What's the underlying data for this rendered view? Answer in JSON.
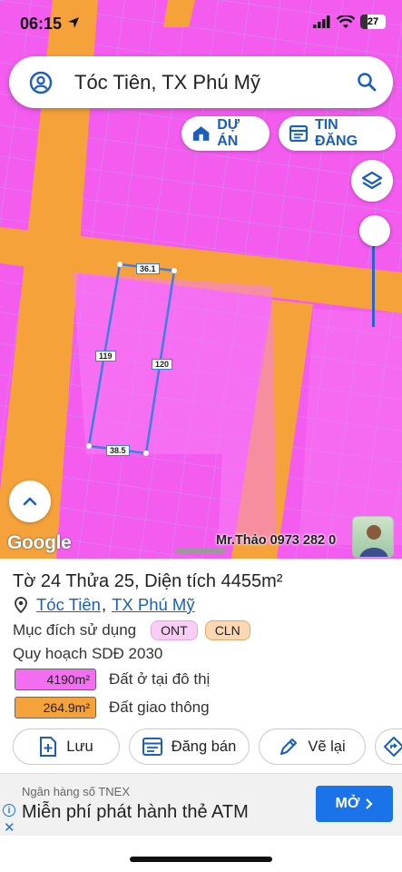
{
  "status_bar": {
    "time": "06:15",
    "battery": "27",
    "battery_level": 0.27
  },
  "search": {
    "location": "Tóc Tiên, TX Phú Mỹ"
  },
  "map_buttons": {
    "du_an": "DỰ ÁN",
    "tin_dang": "TIN ĐĂNG"
  },
  "map": {
    "measurements": {
      "top": "36.1",
      "left": "119",
      "right": "120",
      "bottom": "38.5"
    },
    "logo_text": "Google",
    "watermark": "Mr.Thảo 0973 282 0"
  },
  "parcel": {
    "title": "Tờ 24 Thửa 25, Diện tích 4455m²",
    "location_ward": "Tóc Tiên",
    "location_separator": ",",
    "location_town": "TX Phú Mỹ",
    "purpose_label": "Mục đích sử dụng",
    "purpose_tags": [
      "ONT",
      "CLN"
    ],
    "plan_label": "Quy hoạch SDĐ 2030",
    "areas": [
      {
        "value": "4190m²",
        "label": "Đất ở tại đô thị",
        "color": "#f36ef0"
      },
      {
        "value": "264.9m²",
        "label": "Đất giao thông",
        "color": "#f6a23a"
      }
    ]
  },
  "actions": {
    "save": "Lưu",
    "post": "Đăng bán",
    "redraw": "Vẽ lại"
  },
  "ad": {
    "sponsor": "Ngân hàng số TNEX",
    "headline": "Miễn phí phát hành thẻ ATM",
    "cta": "MỞ"
  },
  "colors": {
    "land_pink": "#f45cf0",
    "road_orange": "#f6a23a",
    "accent_blue": "#1a5fbf",
    "parcel_line": "#3d7fe0"
  }
}
